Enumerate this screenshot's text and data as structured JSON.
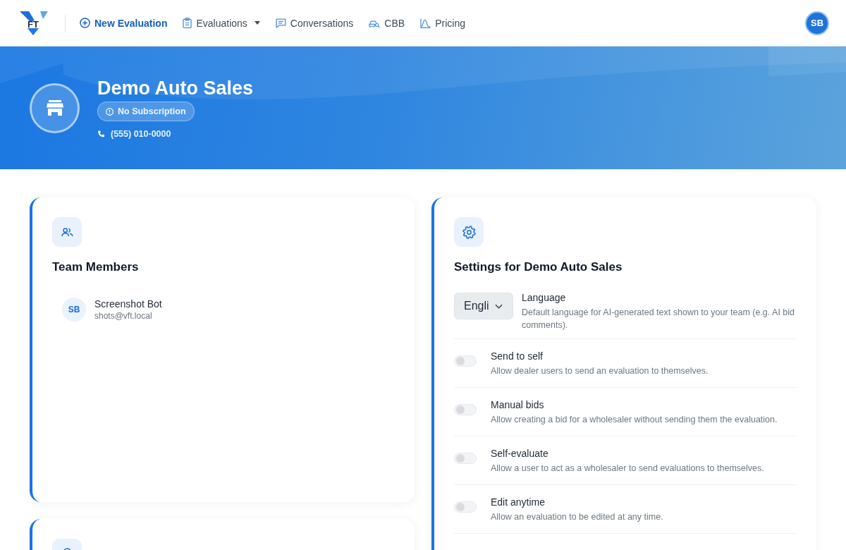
{
  "navbar": {
    "logo": "FT",
    "items": [
      {
        "label": "New Evaluation",
        "primary": true,
        "dropdown": false
      },
      {
        "label": "Evaluations",
        "primary": false,
        "dropdown": true
      },
      {
        "label": "Conversations",
        "primary": false,
        "dropdown": false
      },
      {
        "label": "CBB",
        "primary": false,
        "dropdown": false
      },
      {
        "label": "Pricing",
        "primary": false,
        "dropdown": false
      }
    ],
    "user_initials": "SB"
  },
  "dealer": {
    "name": "Demo Auto Sales",
    "subscription": "No Subscription",
    "phone": "(555) 010-0000"
  },
  "team": {
    "title": "Team Members",
    "members": [
      {
        "initials": "SB",
        "name": "Screenshot Bot",
        "email": "shots@vft.local"
      }
    ]
  },
  "settings": {
    "title": "Settings for Demo Auto Sales",
    "items": [
      {
        "kind": "select",
        "value": "Engli",
        "label": "Language",
        "description": "Default language for AI-generated text shown to your team (e.g. AI bid comments)."
      },
      {
        "kind": "toggle",
        "on": false,
        "label": "Send to self",
        "description": "Allow dealer users to send an evaluation to themselves."
      },
      {
        "kind": "toggle",
        "on": false,
        "label": "Manual bids",
        "description": "Allow creating a bid for a wholesaler without sending them the evaluation."
      },
      {
        "kind": "toggle",
        "on": false,
        "label": "Self-evaluate",
        "description": "Allow a user to act as a wholesaler to send evaluations to themselves."
      },
      {
        "kind": "toggle",
        "on": false,
        "label": "Edit anytime",
        "description": "Allow an evaluation to be edited at any time."
      }
    ]
  }
}
